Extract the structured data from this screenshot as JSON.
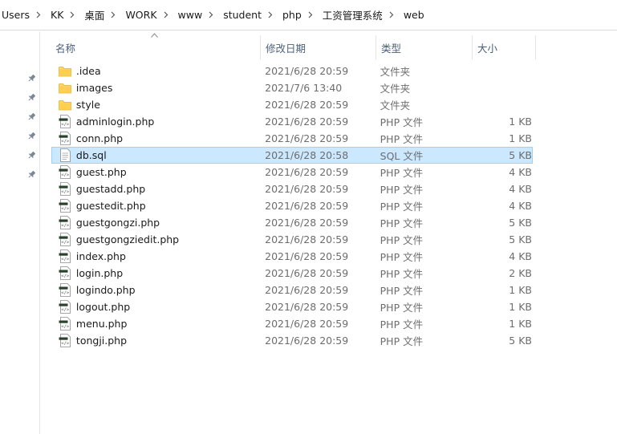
{
  "breadcrumb": [
    "Users",
    "KK",
    "桌面",
    "WORK",
    "www",
    "student",
    "php",
    "工资管理系统",
    "web"
  ],
  "columns": {
    "name": "名称",
    "date": "修改日期",
    "type": "类型",
    "size": "大小"
  },
  "files": [
    {
      "name": ".idea",
      "date": "2021/6/28 20:59",
      "type": "文件夹",
      "size": "",
      "icon": "folder-icon"
    },
    {
      "name": "images",
      "date": "2021/7/6 13:40",
      "type": "文件夹",
      "size": "",
      "icon": "folder-icon"
    },
    {
      "name": "style",
      "date": "2021/6/28 20:59",
      "type": "文件夹",
      "size": "",
      "icon": "folder-icon"
    },
    {
      "name": "adminlogin.php",
      "date": "2021/6/28 20:59",
      "type": "PHP 文件",
      "size": "1 KB",
      "icon": "php-file-icon"
    },
    {
      "name": "conn.php",
      "date": "2021/6/28 20:59",
      "type": "PHP 文件",
      "size": "1 KB",
      "icon": "php-file-icon"
    },
    {
      "name": "db.sql",
      "date": "2021/6/28 20:58",
      "type": "SQL 文件",
      "size": "5 KB",
      "icon": "sql-file-icon",
      "selected": true
    },
    {
      "name": "guest.php",
      "date": "2021/6/28 20:59",
      "type": "PHP 文件",
      "size": "4 KB",
      "icon": "php-file-icon"
    },
    {
      "name": "guestadd.php",
      "date": "2021/6/28 20:59",
      "type": "PHP 文件",
      "size": "4 KB",
      "icon": "php-file-icon"
    },
    {
      "name": "guestedit.php",
      "date": "2021/6/28 20:59",
      "type": "PHP 文件",
      "size": "4 KB",
      "icon": "php-file-icon"
    },
    {
      "name": "guestgongzi.php",
      "date": "2021/6/28 20:59",
      "type": "PHP 文件",
      "size": "5 KB",
      "icon": "php-file-icon"
    },
    {
      "name": "guestgongziedit.php",
      "date": "2021/6/28 20:59",
      "type": "PHP 文件",
      "size": "5 KB",
      "icon": "php-file-icon"
    },
    {
      "name": "index.php",
      "date": "2021/6/28 20:59",
      "type": "PHP 文件",
      "size": "4 KB",
      "icon": "php-file-icon"
    },
    {
      "name": "login.php",
      "date": "2021/6/28 20:59",
      "type": "PHP 文件",
      "size": "2 KB",
      "icon": "php-file-icon"
    },
    {
      "name": "logindo.php",
      "date": "2021/6/28 20:59",
      "type": "PHP 文件",
      "size": "1 KB",
      "icon": "php-file-icon"
    },
    {
      "name": "logout.php",
      "date": "2021/6/28 20:59",
      "type": "PHP 文件",
      "size": "1 KB",
      "icon": "php-file-icon"
    },
    {
      "name": "menu.php",
      "date": "2021/6/28 20:59",
      "type": "PHP 文件",
      "size": "1 KB",
      "icon": "php-file-icon"
    },
    {
      "name": "tongji.php",
      "date": "2021/6/28 20:59",
      "type": "PHP 文件",
      "size": "5 KB",
      "icon": "php-file-icon"
    }
  ],
  "nav_pins": 6,
  "colors": {
    "selection_bg": "#cce8ff",
    "selection_border": "#99d1ff",
    "folder": "#ffd766",
    "header_text": "#4c607a"
  }
}
